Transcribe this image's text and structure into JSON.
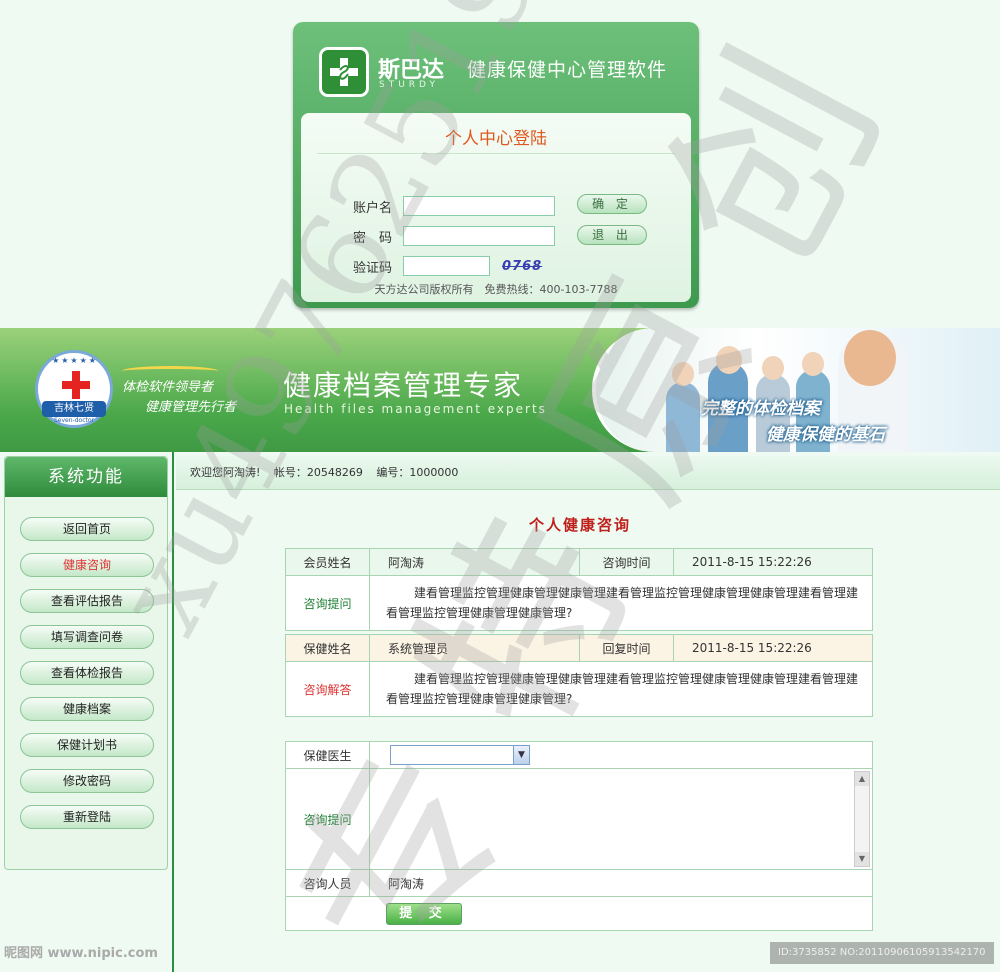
{
  "login": {
    "brand": "斯巴达",
    "brand_en": "STURDY",
    "app_name": "健康保健中心管理软件",
    "title": "个人中心登陆",
    "account_label": "账户名",
    "password_label": "密　码",
    "captcha_label": "验证码",
    "captcha_value": "0768",
    "confirm_label": "确 定",
    "exit_label": "退 出",
    "footer": "天方达公司版权所有　免费热线：400-103-7788"
  },
  "banner": {
    "logo_text": "吉林七贤",
    "logo_en": "Seven-doctor",
    "slogan1": "体检软件领导者",
    "slogan2": "健康管理先行者",
    "title": "健康档案管理专家",
    "subtitle": "Health files management experts",
    "tag1": "完整的体检档案",
    "tag2": "健康保健的基石"
  },
  "sidebar": {
    "title": "系统功能",
    "items": [
      {
        "label": "返回首页"
      },
      {
        "label": "健康咨询"
      },
      {
        "label": "查看评估报告"
      },
      {
        "label": "填写调查问卷"
      },
      {
        "label": "查看体检报告"
      },
      {
        "label": "健康档案"
      },
      {
        "label": "保健计划书"
      },
      {
        "label": "修改密码"
      },
      {
        "label": "重新登陆"
      }
    ],
    "active_index": 1
  },
  "welcome": {
    "greeting": "欢迎您阿淘涛!",
    "account": "帐号：20548269",
    "number": "编号：1000000"
  },
  "consult": {
    "title": "个人健康咨询",
    "member_label": "会员姓名",
    "member_name": "阿淘涛",
    "consult_time_label": "咨询时间",
    "consult_time": "2011-8-15 15:22:26",
    "question_label": "咨询提问",
    "question_text": "建看管理监控管理健康管理健康管理建看管理监控管理健康管理健康管理建看管理建看管理监控管理健康管理健康管理?",
    "doctor_label": "保健姓名",
    "doctor_name": "系统管理员",
    "reply_time_label": "回复时间",
    "reply_time": "2011-8-15 15:22:26",
    "answer_label": "咨询解答",
    "answer_text": "建看管理监控管理健康管理健康管理建看管理监控管理健康管理健康管理建看管理建看管理监控管理健康管理健康管理?"
  },
  "form": {
    "doctor_label": "保健医生",
    "doctor_selected": "",
    "question_label": "咨询提问",
    "question_value": "",
    "person_label": "咨询人员",
    "person_name": "阿淘涛",
    "submit_label": "提 交"
  },
  "watermarks": {
    "text1": "xu4976251999",
    "text2": "专 特 原 创",
    "site": "昵图网 www.nipic.com",
    "id": "ID:3735852 NO:20110906105913542170"
  },
  "colors": {
    "primary_green": "#3e9a4e",
    "title_red": "#c0201c",
    "login_title_orange": "#e0581f",
    "active_menu_red": "#dd3333"
  }
}
